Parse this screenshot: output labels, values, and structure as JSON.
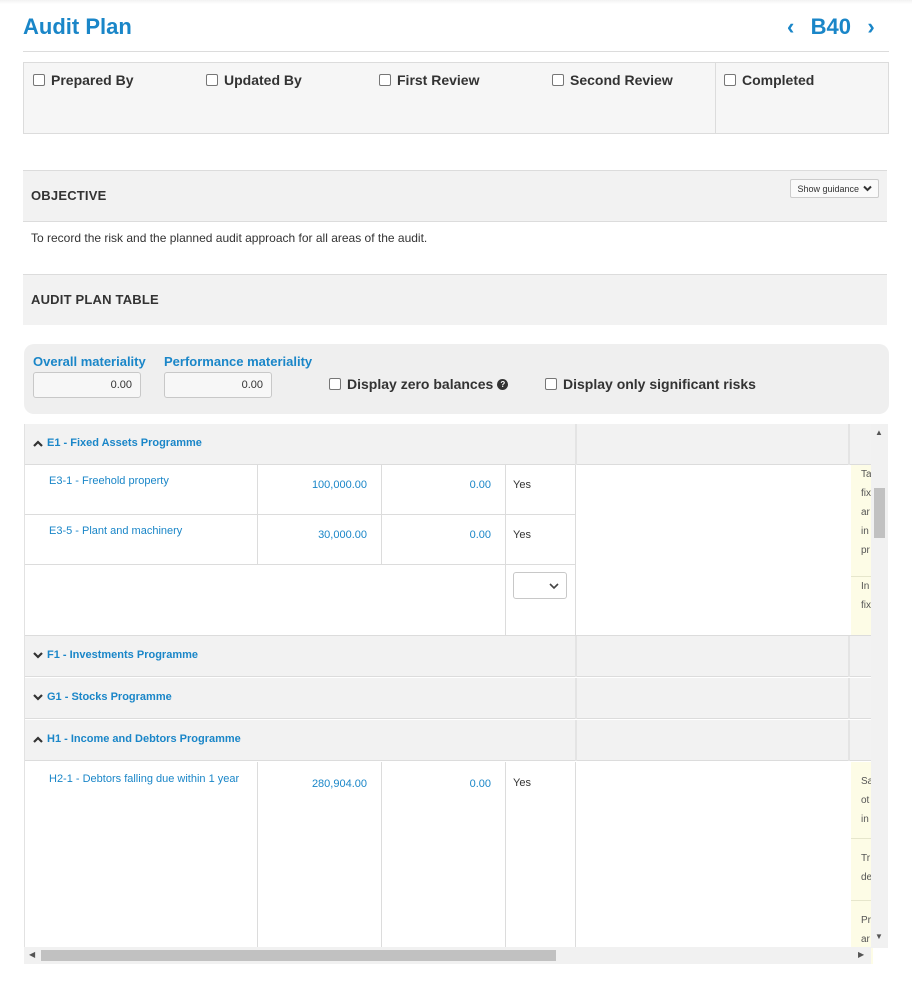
{
  "header": {
    "title": "Audit Plan",
    "code": "B40",
    "prev_icon": "‹",
    "next_icon": "›"
  },
  "signoff": {
    "items": [
      {
        "label": "Prepared By",
        "checked": false
      },
      {
        "label": "Updated By",
        "checked": false
      },
      {
        "label": "First Review",
        "checked": false
      },
      {
        "label": "Second Review",
        "checked": false
      },
      {
        "label": "Completed",
        "checked": false
      }
    ]
  },
  "objective": {
    "title": "OBJECTIVE",
    "guidance_label": "Show guidance",
    "text": "To record the risk and the planned audit approach for all areas of the audit."
  },
  "audit_plan": {
    "title": "AUDIT PLAN TABLE"
  },
  "materiality": {
    "overall_label": "Overall materiality",
    "overall_value": "0.00",
    "performance_label": "Performance materiality",
    "performance_value": "0.00",
    "zero_balances_label": "Display zero balances",
    "significant_label": "Display only significant risks"
  },
  "grid": {
    "groups": [
      {
        "code": "E1",
        "name": "E1 - Fixed Assets Programme",
        "expanded": true
      },
      {
        "code": "F1",
        "name": "F1 - Investments Programme",
        "expanded": false
      },
      {
        "code": "G1",
        "name": "G1 - Stocks Programme",
        "expanded": false
      },
      {
        "code": "H1",
        "name": "H1 - Income and Debtors Programme",
        "expanded": true
      }
    ],
    "rows": [
      {
        "label": "E3-1 - Freehold property",
        "value": "100,000.00",
        "materiality": "0.00",
        "significant": "Yes"
      },
      {
        "label": "E3-5 - Plant and machinery",
        "value": "30,000.00",
        "materiality": "0.00",
        "significant": "Yes"
      },
      {
        "label": "H2-1 - Debtors falling due within 1 year",
        "value": "280,904.00",
        "materiality": "0.00",
        "significant": "Yes"
      }
    ],
    "notes_e1": [
      "Ta",
      "fix",
      "ar",
      "in",
      "pr",
      "In",
      "fix"
    ],
    "notes_h1": [
      "Sa",
      "ot",
      "in",
      "Tr",
      "de",
      "Pr",
      "ar"
    ]
  }
}
